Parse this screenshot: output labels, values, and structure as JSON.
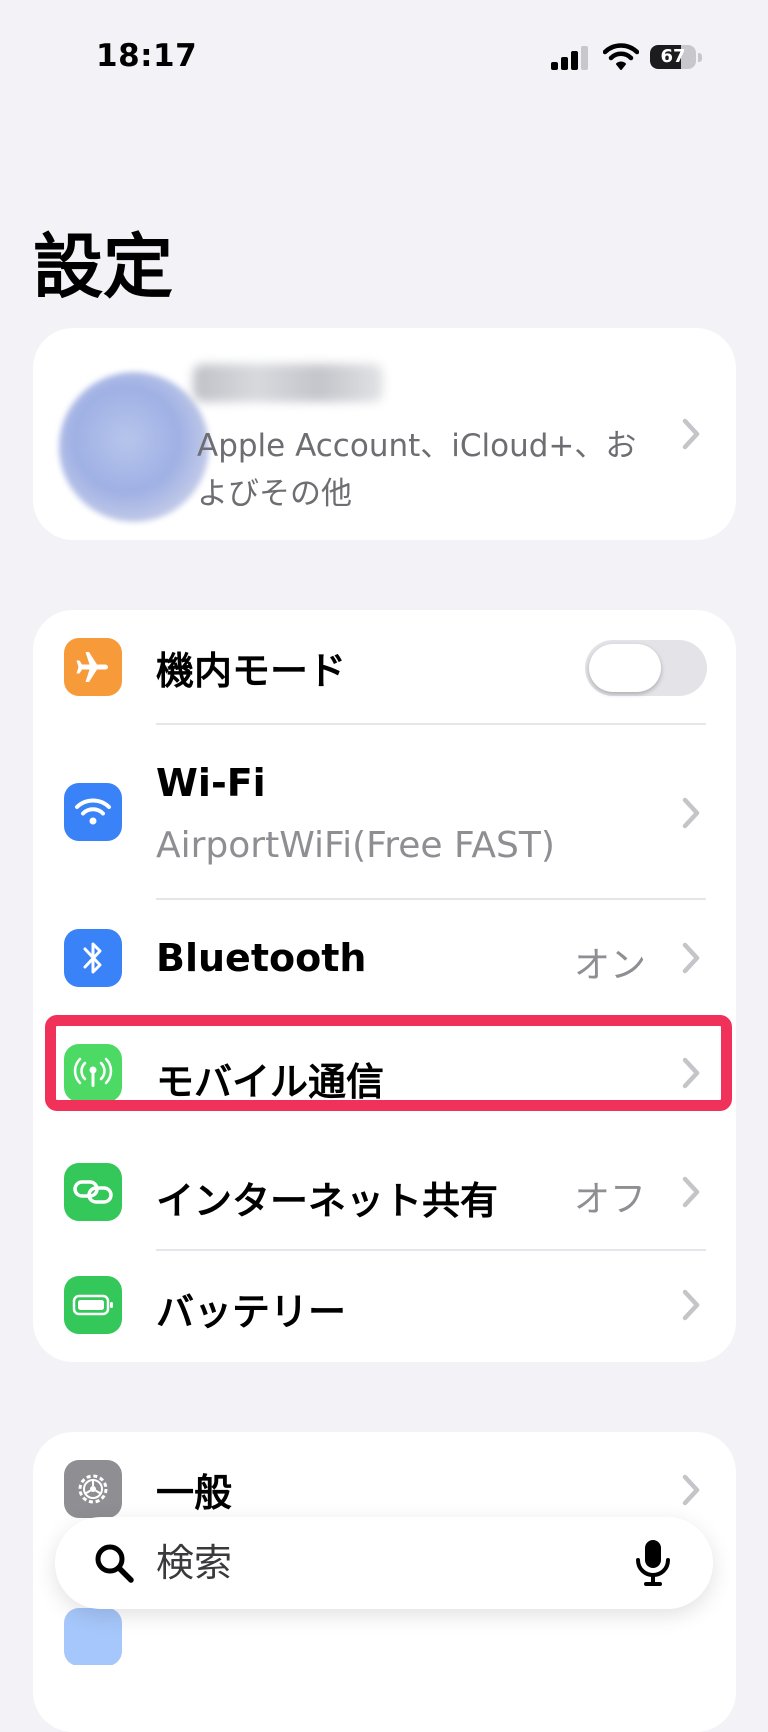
{
  "status_bar": {
    "time": "18:17",
    "battery_level": "67",
    "battery_fraction": 0.67,
    "signal_icon": "cellular-signal-icon",
    "wifi_icon": "wifi-icon"
  },
  "title": "設定",
  "account": {
    "name": "名前",
    "subtitle": "Apple Account、iCloud+、およびその他"
  },
  "rows": [
    {
      "id": "airplane",
      "label": "機内モード",
      "icon": "airplane-icon",
      "icon_color": "#f79a3a",
      "toggle": "off"
    },
    {
      "id": "wifi",
      "label": "Wi-Fi",
      "sub": "AirportWiFi(Free FAST)",
      "icon": "wifi-icon",
      "icon_color": "#3a82f7"
    },
    {
      "id": "bluetooth",
      "label": "Bluetooth",
      "value": "オン",
      "icon": "bluetooth-icon",
      "icon_color": "#3a82f7"
    },
    {
      "id": "cellular",
      "label": "モバイル通信",
      "icon": "antenna-icon",
      "icon_color": "#4cd964",
      "highlighted": true
    },
    {
      "id": "hotspot",
      "label": "インターネット共有",
      "value": "オフ",
      "icon": "link-icon",
      "icon_color": "#34c759"
    },
    {
      "id": "battery",
      "label": "バッテリー",
      "icon": "battery-icon",
      "icon_color": "#34c759"
    }
  ],
  "general": {
    "label": "一般",
    "icon": "gear-icon",
    "icon_color": "#8e8e93"
  },
  "search": {
    "placeholder": "検索"
  },
  "highlight_color": "#f0325a"
}
